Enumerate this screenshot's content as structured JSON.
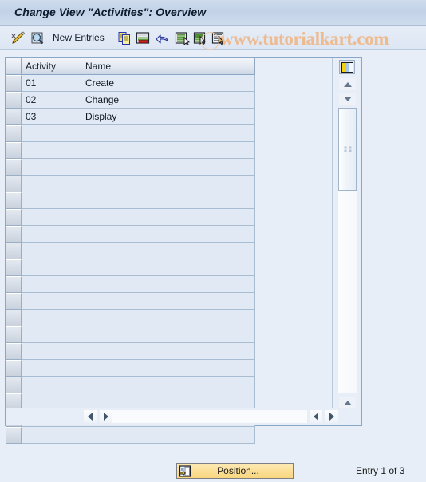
{
  "window": {
    "title": "Change View \"Activities\": Overview"
  },
  "toolbar": {
    "items": [
      {
        "name": "display-change-icon",
        "icon": "pencil-magnify-icon",
        "label": ""
      },
      {
        "name": "check-entries-icon",
        "icon": "magnifier-icon",
        "label": ""
      },
      {
        "name": "new-entries-button",
        "icon": "",
        "label": "New Entries"
      },
      {
        "name": "copy-as-icon",
        "icon": "copy-icon",
        "label": ""
      },
      {
        "name": "delete-icon",
        "icon": "delete-row-icon",
        "label": ""
      },
      {
        "name": "undo-icon",
        "icon": "undo-arrow-icon",
        "label": ""
      },
      {
        "name": "select-all-icon",
        "icon": "select-all-icon",
        "label": ""
      },
      {
        "name": "select-block-icon",
        "icon": "select-block-icon",
        "label": ""
      },
      {
        "name": "deselect-all-icon",
        "icon": "deselect-all-icon",
        "label": ""
      }
    ]
  },
  "watermark": {
    "text": "www.tutorialkart.com",
    "color": "#edbb8f"
  },
  "table": {
    "columns": [
      {
        "key": "activity",
        "label": "Activity"
      },
      {
        "key": "name",
        "label": "Name"
      }
    ],
    "rows": [
      {
        "activity": "01",
        "name": "Create"
      },
      {
        "activity": "02",
        "name": "Change"
      },
      {
        "activity": "03",
        "name": "Display"
      }
    ],
    "empty_row_count": 19,
    "settings_icon": "table-settings-icon"
  },
  "scrollbars": {
    "vertical": {
      "up": "scroll-up-arrow",
      "down": "scroll-down-arrow"
    },
    "horizontal": {
      "left": "scroll-left-arrow",
      "right": "scroll-right-arrow"
    }
  },
  "footer": {
    "position_button": {
      "label": "Position...",
      "icon": "position-icon",
      "color": "#fbdf95"
    },
    "entry_status": "Entry 1 of 3"
  }
}
